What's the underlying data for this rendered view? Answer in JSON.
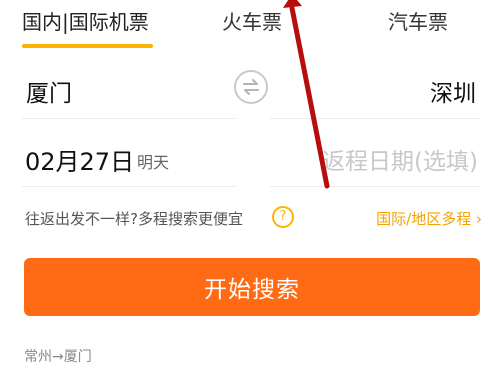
{
  "tabs": [
    {
      "label": "国内|国际机票",
      "active": true
    },
    {
      "label": "火车票",
      "active": false
    },
    {
      "label": "汽车票",
      "active": false
    }
  ],
  "route": {
    "departure_city": "厦门",
    "arrival_city": "深圳",
    "swap_icon": "swap-arrows-icon"
  },
  "dates": {
    "departure_date": "02月27日",
    "departure_weekday": "明天",
    "return_placeholder": "返程日期(选填)"
  },
  "hint": {
    "text": "往返出发不一样?多程搜索更便宜",
    "help_symbol": "?",
    "multi_trip_link": "国际/地区多程 ›"
  },
  "search_button_label": "开始搜索",
  "history_item": "常州→厦门",
  "colors": {
    "accent_yellow": "#ffb300",
    "search_orange": "#ff6a14",
    "link_orange": "#f4a300",
    "annotation_red": "#b80d0d"
  }
}
